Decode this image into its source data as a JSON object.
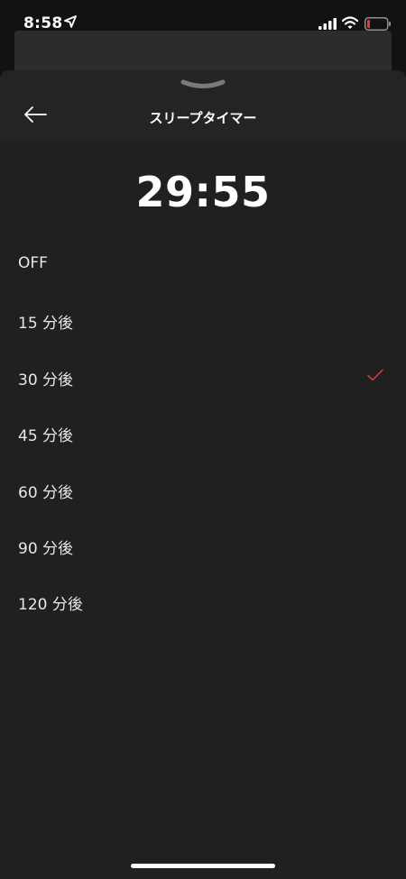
{
  "status_bar": {
    "time": "8:58",
    "icons": [
      "location-arrow-icon",
      "cellular-signal-icon",
      "wifi-icon",
      "battery-low-icon"
    ],
    "battery_color": "#e0393e"
  },
  "header": {
    "title": "スリープタイマー",
    "back_icon": "arrow-left-icon",
    "grabber_icon": "chevron-down-icon"
  },
  "timer": {
    "remaining": "29:55"
  },
  "options": [
    {
      "label": "OFF",
      "selected": false
    },
    {
      "label": "15 分後",
      "selected": false
    },
    {
      "label": "30 分後",
      "selected": true
    },
    {
      "label": "45 分後",
      "selected": false
    },
    {
      "label": "60 分後",
      "selected": false
    },
    {
      "label": "90 分後",
      "selected": false
    },
    {
      "label": "120 分後",
      "selected": false
    }
  ],
  "colors": {
    "background": "#202020",
    "header_background": "#242424",
    "accent_check": "#e0393e",
    "text": "#ffffff"
  }
}
